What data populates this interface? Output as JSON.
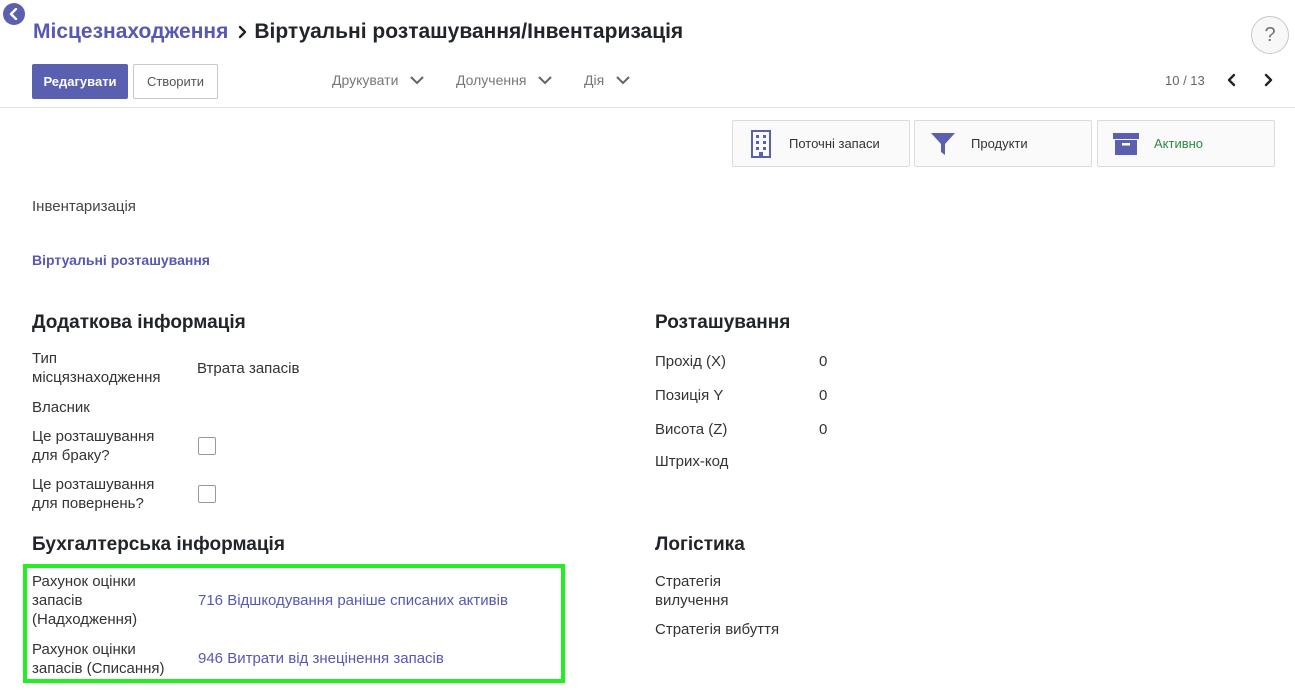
{
  "breadcrumb": {
    "parent": "Місцезнаходження",
    "current": "Віртуальні розташування/Інвентаризація"
  },
  "help": {
    "label": "?"
  },
  "toolbar": {
    "edit_label": "Редагувати",
    "create_label": "Створити",
    "print_label": "Друкувати",
    "attach_label": "Долучення",
    "action_label": "Дія"
  },
  "pager": {
    "value": "10 / 13"
  },
  "smart_buttons": {
    "stock": "Поточні запаси",
    "products": "Продукти",
    "active": "Активно"
  },
  "form": {
    "name": "Інвентаризація",
    "parent_location": "Віртуальні розташування",
    "additional_info": {
      "title": "Додаткова інформація",
      "location_type_label": "Тип місцязнаходження",
      "location_type_value": "Втрата запасів",
      "owner_label": "Власник",
      "scrap_label": "Це розташування для браку?",
      "return_label": "Це розташування для повернень?"
    },
    "accounting": {
      "title": "Бухгалтерська інформація",
      "valuation_in_label": "Рахунок оцінки запасів (Надходження)",
      "valuation_in_value": "716 Відшкодування раніше списаних активів",
      "valuation_out_label": "Рахунок оцінки запасів (Списання)",
      "valuation_out_value": "946 Витрати від знецінення запасів"
    },
    "localization": {
      "title": "Розташування",
      "x_label": "Прохід (X)",
      "x_value": "0",
      "y_label": "Позиція Y",
      "y_value": "0",
      "z_label": "Висота (Z)",
      "z_value": "0",
      "barcode_label": "Штрих-код"
    },
    "logistics": {
      "title": "Логістика",
      "removal_label": "Стратегія вилучення",
      "putaway_label": "Стратегія вибуття"
    }
  },
  "colors": {
    "primary": "#5a5fb0",
    "link": "#5658b3",
    "highlight": "#22ee22",
    "active": "#2d8a3f"
  }
}
